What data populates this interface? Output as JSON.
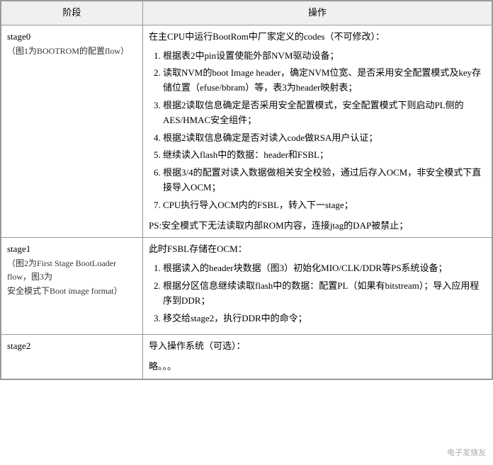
{
  "table": {
    "headers": {
      "stage": "阶段",
      "action": "操作"
    },
    "rows": [
      {
        "stage_name": "stage0",
        "stage_desc": "（图1为BOOTROM的配置flow）",
        "action_intro": "在主CPU中运行BootRom中厂家定义的codes（不可修改）：",
        "action_items": [
          "根据表2中pin设置使能外部NVM驱动设备；",
          "读取NVM的boot Image header，确定NVM位宽、是否采用安全配置模式及key存储位置（efuse/bbram）等，表3为header映射表；",
          "根据2读取信息确定是否采用安全配置模式，安全配置模式下则启动PL侧的AES/HMAC安全组件；",
          "根据2读取信息确定是否对读入code做RSA用户认证；",
          "继续读入flash中的数据：header和FSBL；",
          "根据3/4的配置对读入数据做相关安全校验，通过后存入OCM，非安全模式下直接导入OCM；",
          "CPU执行导入OCM内的FSBL，转入下一stage；"
        ],
        "ps_note": "PS:安全模式下无法读取内部ROM内容，连接jtag的DAP被禁止；"
      },
      {
        "stage_name": "stage1",
        "stage_desc": "（图2为First Stage BootLoader flow，图3为\n安全模式下Boot image format）",
        "action_intro": "此时FSBL存储在OCM：",
        "action_items": [
          "根据读入的header块数据（图3）初始化MIO/CLK/DDR等PS系统设备；",
          "根据分区信息继续读取flash中的数据：配置PL（如果有bitstream）；导入应用程序到DDR；",
          "移交给stage2，执行DDR中的命令；"
        ],
        "ps_note": ""
      },
      {
        "stage_name": "stage2",
        "stage_desc": "",
        "action_intro": "导入操作系统（可选）：",
        "action_items": [],
        "ps_note": "略。。。"
      }
    ]
  },
  "watermark": "电子发烧友"
}
